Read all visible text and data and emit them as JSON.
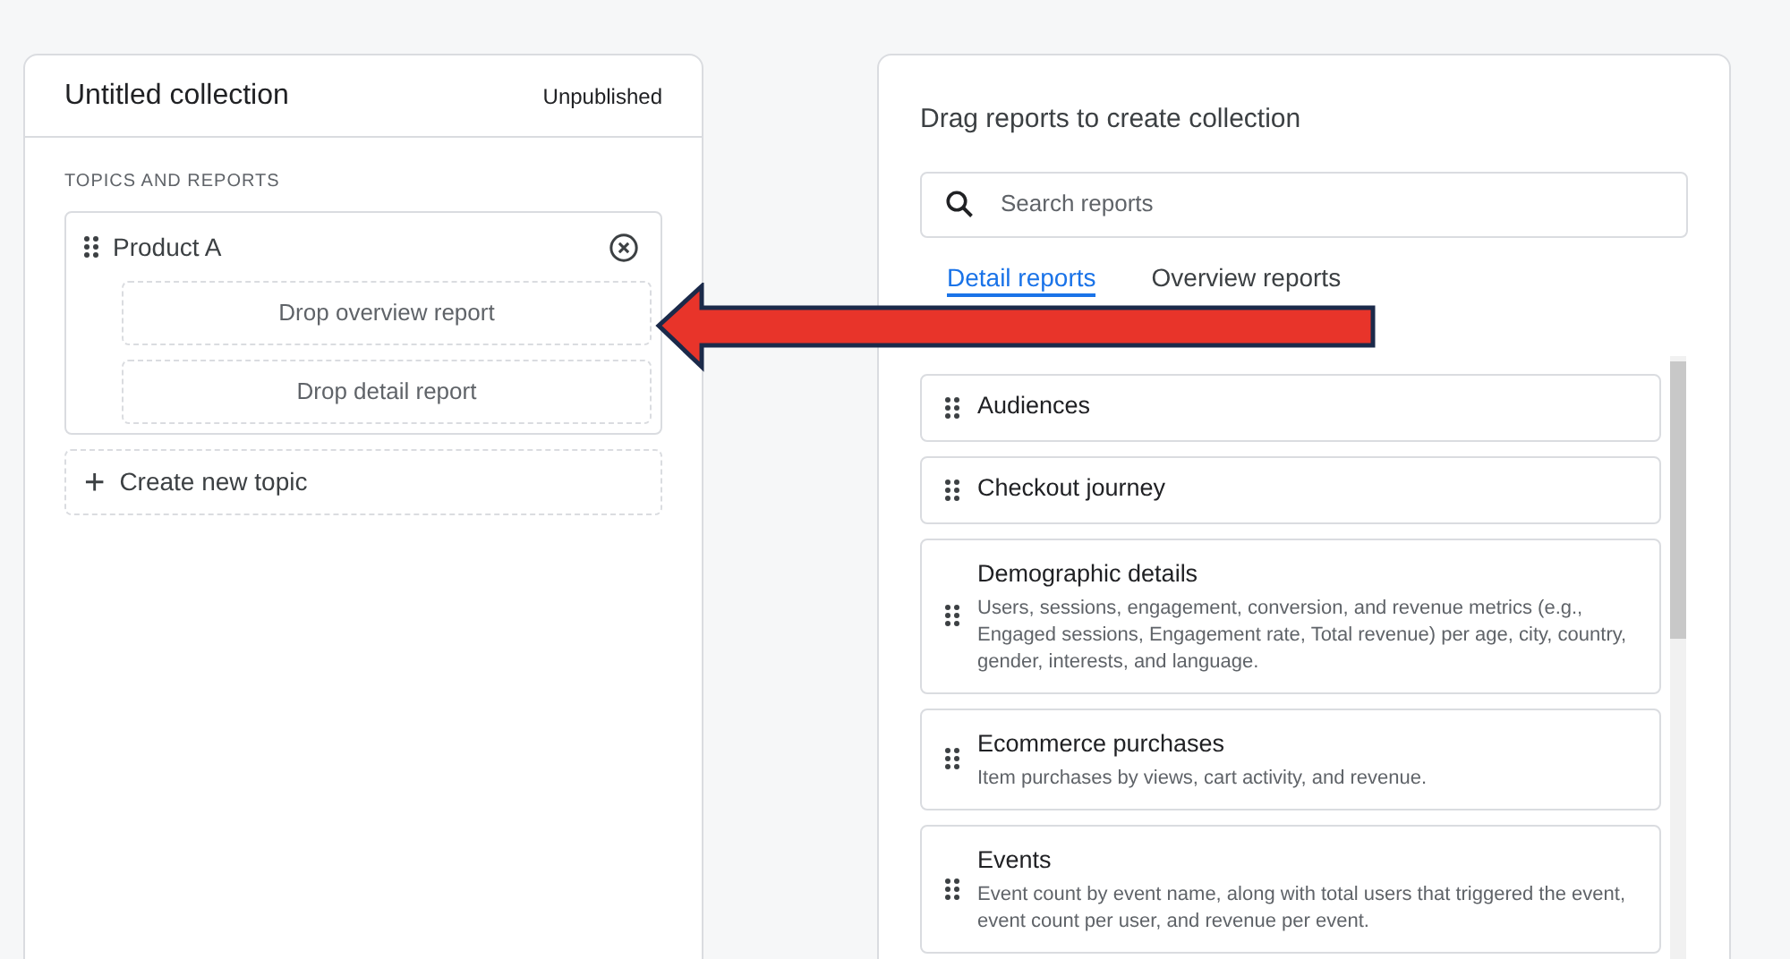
{
  "collection": {
    "title": "Untitled collection",
    "status": "Unpublished",
    "section_label": "TOPICS AND REPORTS",
    "topics": [
      {
        "name": "Product A",
        "slots": [
          "Drop overview report",
          "Drop detail report"
        ]
      }
    ],
    "create_topic": {
      "icon": "+",
      "label": "Create new topic"
    }
  },
  "library": {
    "title": "Drag reports to create collection",
    "search": {
      "placeholder": "Search reports"
    },
    "tabs": [
      {
        "label": "Detail reports",
        "selected": true
      },
      {
        "label": "Overview reports",
        "selected": false
      }
    ],
    "reports": [
      {
        "title": "Audiences"
      },
      {
        "title": "Checkout journey"
      },
      {
        "title": "Demographic details",
        "description": "Users, sessions, engagement, conversion, and revenue metrics (e.g., Engaged sessions, Engagement rate, Total revenue) per age, city, country, gender, interests, and language."
      },
      {
        "title": "Ecommerce purchases",
        "description": "Item purchases by views, cart activity, and revenue."
      },
      {
        "title": "Events",
        "description": "Event count by event name, along with total users that triggered the event, event count per user, and revenue per event."
      }
    ]
  },
  "annotation": {
    "kind": "arrow",
    "color": "#e8342a"
  }
}
